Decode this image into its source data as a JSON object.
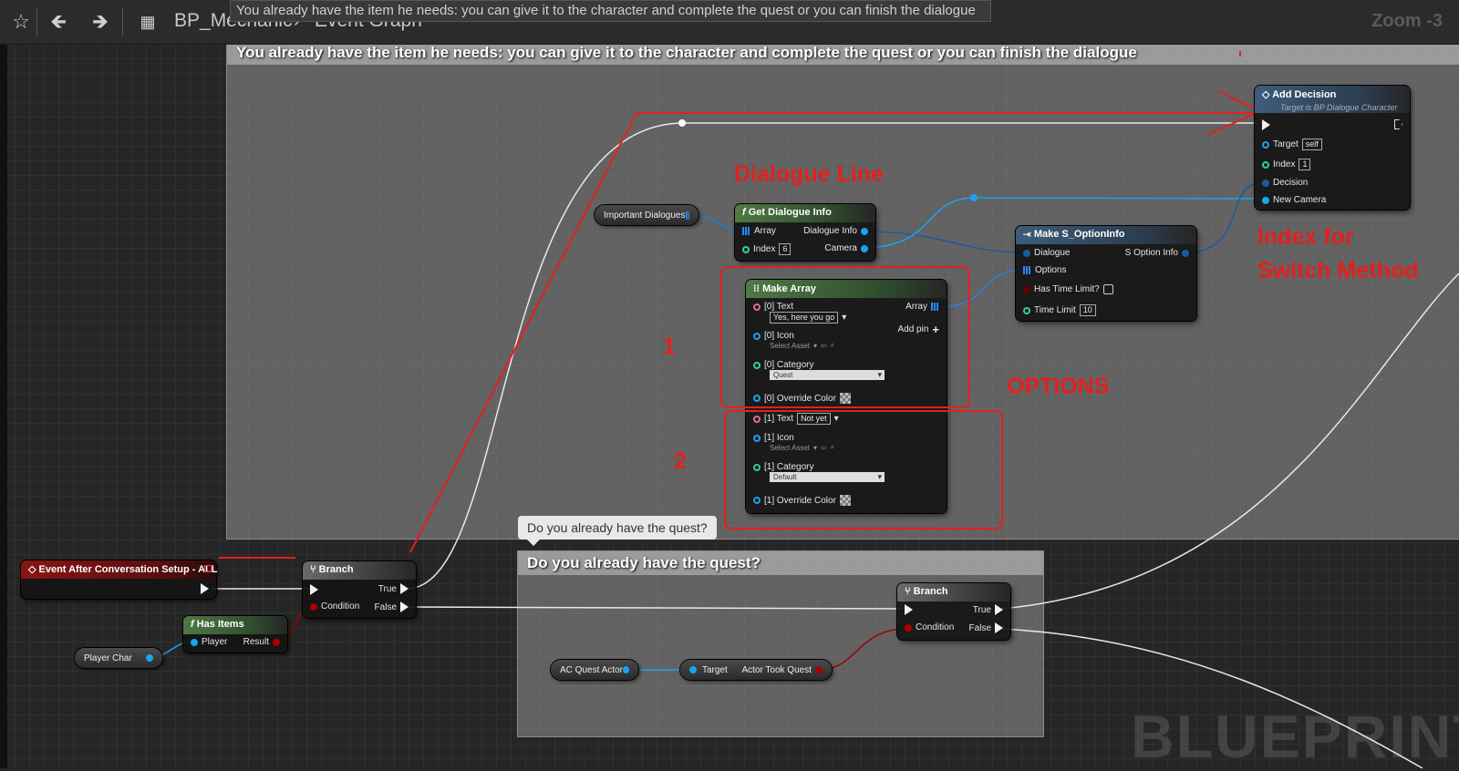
{
  "toolbar": {
    "breadcrumb_blueprint": "BP_Mechanic",
    "breadcrumb_graph": "Event Graph",
    "tooltip_text": "You already have the item he needs: you can give it to the character and complete the quest or you can finish the dialogue",
    "zoom": "Zoom -3"
  },
  "comments": {
    "top_title": "You already have the item he needs: you can give it to the character and complete the quest or you can finish the dialogue",
    "bottom_title": "Do you already have the quest?",
    "bubble_text": "Do you already have the quest?"
  },
  "nodes": {
    "event": {
      "title": "Event After Conversation Setup - ALL"
    },
    "branch1": {
      "title": "Branch",
      "condition": "Condition",
      "true_label": "True",
      "false_label": "False"
    },
    "has_items": {
      "title": "Has Items",
      "player": "Player",
      "result": "Result"
    },
    "player_char": {
      "label": "Player Char"
    },
    "important_dialogues": {
      "label": "Important Dialogues"
    },
    "get_dialogue_info": {
      "title": "Get Dialogue Info",
      "array": "Array",
      "index": "Index",
      "index_value": "6",
      "dialogue_info": "Dialogue Info",
      "camera": "Camera"
    },
    "make_array": {
      "title": "Make Array",
      "array": "Array",
      "add_pin": "Add pin",
      "text0": "[0] Text",
      "text0_value": "Yes, here you go",
      "icon0": "[0] Icon",
      "icon0_value": "Select Asset",
      "category0": "[0] Category",
      "category0_value": "Quest",
      "color0": "[0] Override Color",
      "text1": "[1] Text",
      "text1_value": "Not yet",
      "icon1": "[1] Icon",
      "icon1_value": "Select Asset",
      "category1": "[1] Category",
      "category1_value": "Default",
      "color1": "[1] Override Color"
    },
    "make_option": {
      "title": "Make S_OptionInfo",
      "dialogue": "Dialogue",
      "options": "Options",
      "has_time_limit": "Has Time Limit?",
      "time_limit": "Time Limit",
      "time_limit_value": "10",
      "output": "S Option Info"
    },
    "add_decision": {
      "title": "Add Decision",
      "subtitle": "Target is BP Dialogue Character",
      "target": "Target",
      "target_value": "self",
      "index": "Index",
      "index_value": "1",
      "decision": "Decision",
      "new_camera": "New Camera"
    },
    "branch2": {
      "title": "Branch",
      "condition": "Condition",
      "true_label": "True",
      "false_label": "False"
    },
    "ac_quest_actor": {
      "label": "AC Quest Actor"
    },
    "actor_took_quest": {
      "target": "Target",
      "output": "Actor Took Quest"
    }
  },
  "annotations": {
    "dialogue_line": "Dialogue Line",
    "index_for_1": "Index for",
    "index_for_2": "Switch Method",
    "options": "OPTIONS",
    "num1": "1",
    "num2": "2"
  },
  "watermark": "BLUEPRINT",
  "colors": {
    "annotation_red": "#e32020",
    "exec_white": "#f0f0f0",
    "object_pin_blue": "#1ba3f0",
    "bool_pin_red": "#a00000"
  }
}
